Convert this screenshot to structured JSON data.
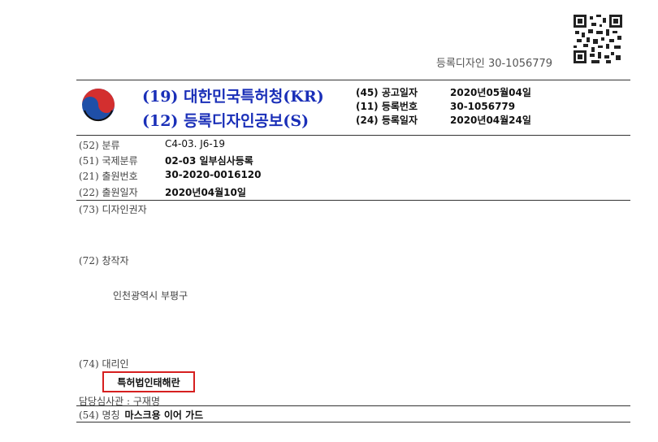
{
  "header": {
    "registration_type_label": "등록디자인",
    "registration_number": "30-1056779"
  },
  "office": {
    "line1": "(19) 대한민국특허청(KR)",
    "line2": "(12) 등록디자인공보(S)"
  },
  "publication": {
    "rows": [
      {
        "label": "(45) 공고일자",
        "value": "2020년05월04일"
      },
      {
        "label": "(11) 등록번호",
        "value": "30-1056779"
      },
      {
        "label": "(24) 등록일자",
        "value": "2020년04월24일"
      }
    ]
  },
  "fields": {
    "classification": {
      "label": "(52) 분류",
      "value": "C4-03. J6-19"
    },
    "intl_classification": {
      "label": "(51) 국제분류",
      "value": "02-03 일부심사등록"
    },
    "application_number": {
      "label": "(21) 출원번호",
      "value": "30-2020-0016120"
    },
    "application_date": {
      "label": "(22) 출원일자",
      "value": "2020년04월10일"
    }
  },
  "rights_holder": {
    "label": "(73) 디자인권자"
  },
  "creator": {
    "label": "(72) 창작자",
    "address": "인천광역시 부평구"
  },
  "agent": {
    "label": "(74) 대리인",
    "name": "특허법인태해란"
  },
  "examiner": {
    "text": "담당심사관 : 구재명"
  },
  "title": {
    "label": "(54) 명칭",
    "value": "마스크용 이어 가드"
  },
  "colors": {
    "office_blue": "#1a2fb8",
    "highlight_red": "#d61f1f",
    "logo_red": "#d32f2f",
    "logo_blue": "#1f4fa8"
  },
  "icons": {
    "qr": "qr-code-icon",
    "logo": "kipo-taegeuk-logo"
  }
}
